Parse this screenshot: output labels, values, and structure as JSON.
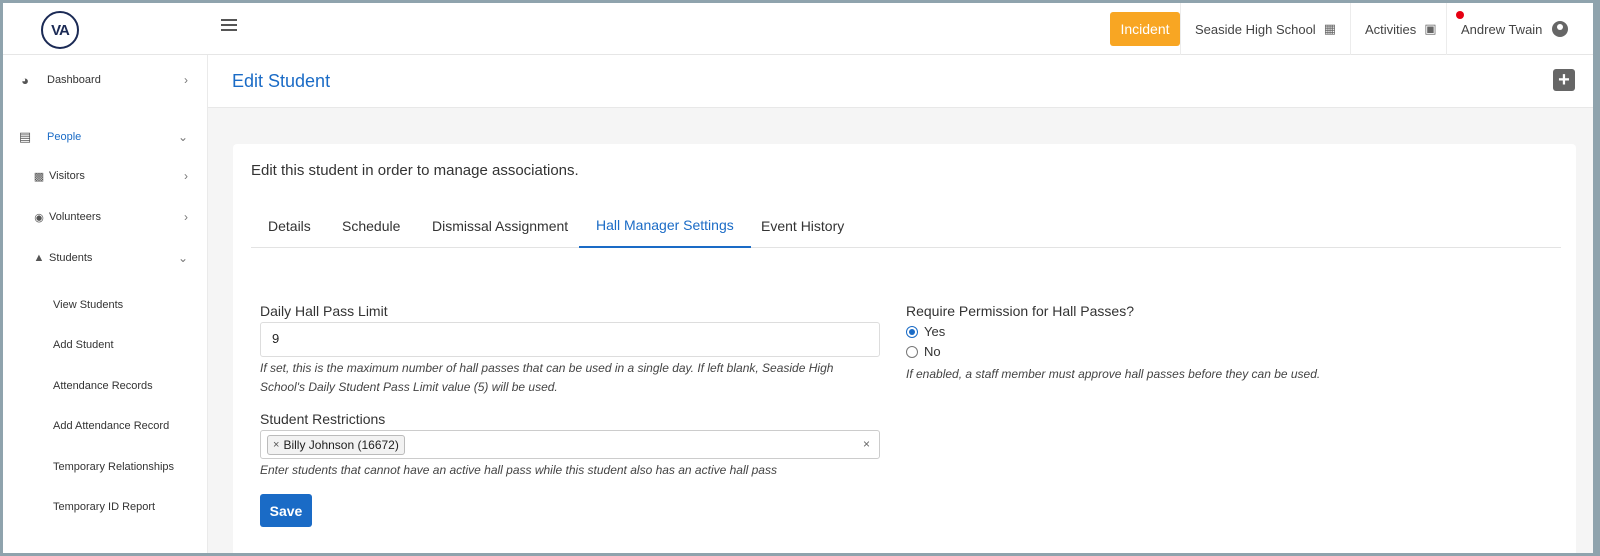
{
  "app": {
    "logo_text": "VA"
  },
  "topbar": {
    "incident_label": "Incident",
    "school": "Seaside High School",
    "activities": "Activities",
    "user": "Andrew Twain"
  },
  "sidebar": {
    "dashboard": "Dashboard",
    "people": "People",
    "visitors": "Visitors",
    "volunteers": "Volunteers",
    "students": "Students",
    "students_sub": [
      "View Students",
      "Add Student",
      "Attendance Records",
      "Add Attendance Record",
      "Temporary Relationships",
      "Temporary ID Report"
    ]
  },
  "header": {
    "title": "Edit Student"
  },
  "main": {
    "intro": "Edit this student in order to manage associations.",
    "tabs": [
      "Details",
      "Schedule",
      "Dismissal Assignment",
      "Hall Manager Settings",
      "Event History"
    ],
    "active_tab": "Hall Manager Settings",
    "daily_limit": {
      "label": "Daily Hall Pass Limit",
      "value": "9",
      "help_line1": "If set, this is the maximum number of hall passes that can be used in a single day. If left blank, Seaside High",
      "help_line2": "School's Daily Student Pass Limit value (5) will be used."
    },
    "restrictions": {
      "label": "Student Restrictions",
      "chip": "Billy Johnson (16672)",
      "chip_remove": "×",
      "clear": "×",
      "help": "Enter students that cannot have an active hall pass while this student also has an active hall pass"
    },
    "permission": {
      "label": "Require Permission for Hall Passes?",
      "yes": "Yes",
      "no": "No",
      "selected": "Yes",
      "help": "If enabled, a staff member must approve hall passes before they can be used."
    },
    "save_label": "Save"
  },
  "colors": {
    "accent": "#1a6bc6",
    "incident": "#f8a623",
    "notification": "#e60012"
  }
}
